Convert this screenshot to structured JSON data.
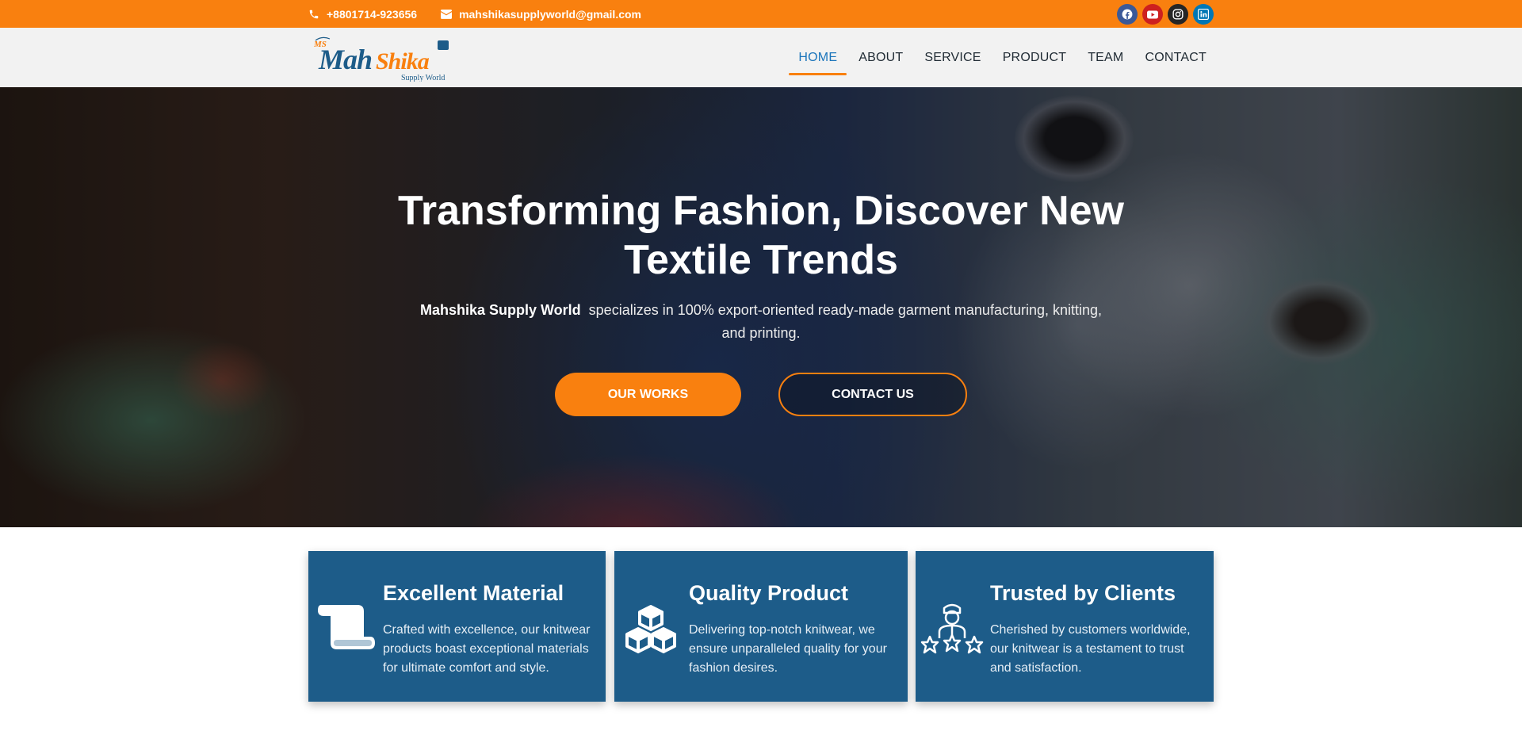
{
  "topbar": {
    "phone": "+8801714-923656",
    "email": "mahshikasupplyworld@gmail.com",
    "socials": [
      {
        "icon": "facebook-icon",
        "color": "#3b5998"
      },
      {
        "icon": "youtube-icon",
        "color": "#cd201f"
      },
      {
        "icon": "instagram-icon",
        "color": "#262626"
      },
      {
        "icon": "linkedin-icon",
        "color": "#0077b5"
      }
    ]
  },
  "logo": {
    "badge": "MS",
    "name_part1": "Mah",
    "name_part2": "Shika",
    "tagline": "Supply World"
  },
  "nav": {
    "items": [
      "HOME",
      "ABOUT",
      "SERVICE",
      "PRODUCT",
      "TEAM",
      "CONTACT"
    ],
    "active": "HOME"
  },
  "hero": {
    "title_line1": "Transforming Fashion, Discover New",
    "title_line2": "Textile Trends",
    "sub_bold": "Mahshika Supply World",
    "sub_rest": "  specializes in 100% export-oriented ready-made garment manufacturing, knitting, and printing.",
    "btn_works": "OUR WORKS",
    "btn_contact": "CONTACT US"
  },
  "features": [
    {
      "icon": "scroll-icon",
      "title": "Excellent Material",
      "text": "Crafted with excellence, our knitwear products boast exceptional materials for ultimate comfort and style."
    },
    {
      "icon": "boxes-icon",
      "title": "Quality Product",
      "text": "Delivering top-notch knitwear, we ensure unparalleled quality for your fashion desires."
    },
    {
      "icon": "client-stars-icon",
      "title": "Trusted by Clients",
      "text": "Cherished by customers worldwide, our knitwear is a testament to trust and satisfaction."
    }
  ],
  "colors": {
    "accent": "#f9800f",
    "brand_blue": "#1d5c89",
    "nav_active": "#1b75bb"
  }
}
